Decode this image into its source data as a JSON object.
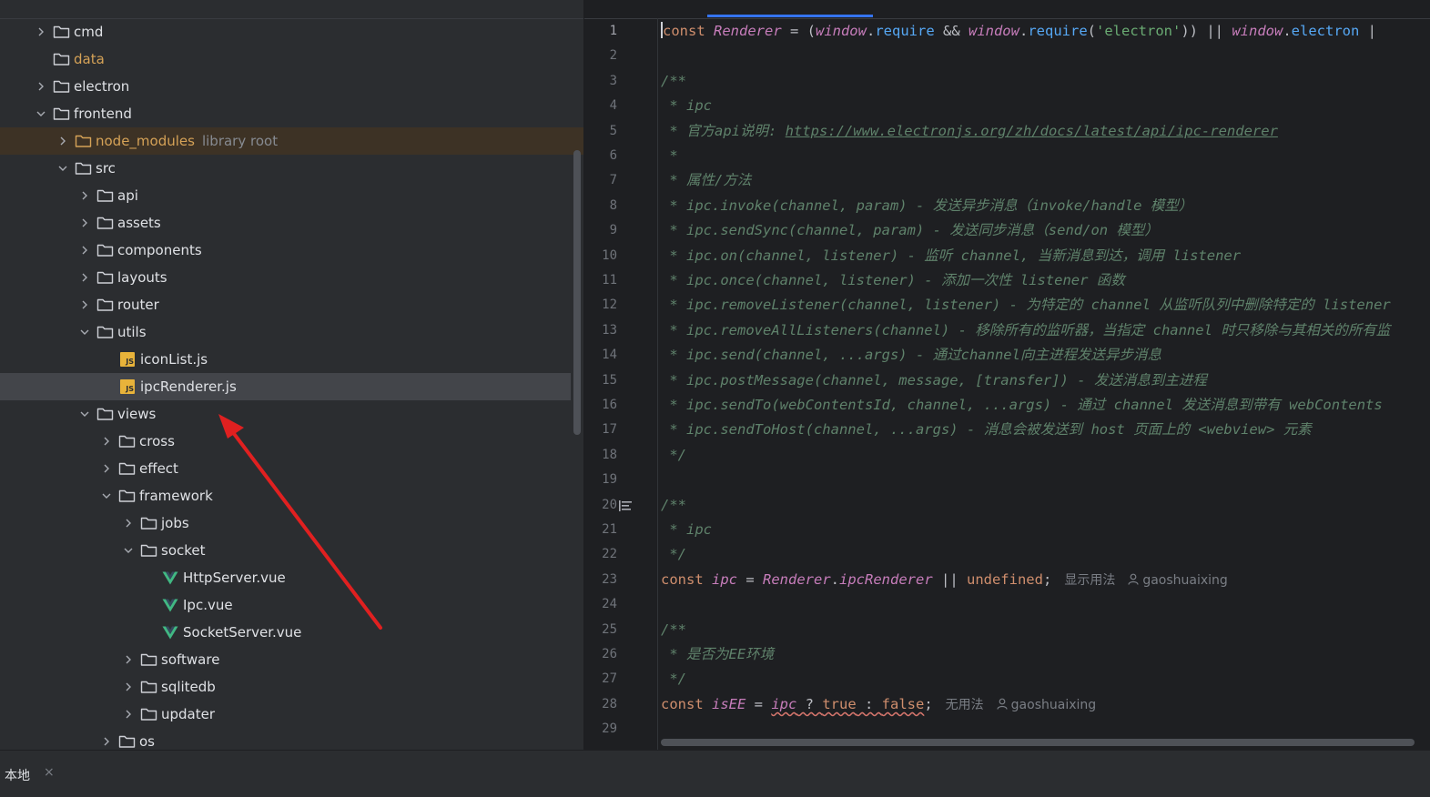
{
  "tree": {
    "items": [
      {
        "label": "cmd",
        "type": "folder",
        "depth": 0,
        "state": "collapsed"
      },
      {
        "label": "data",
        "type": "folder",
        "depth": 0,
        "state": "leaf",
        "style": "data"
      },
      {
        "label": "electron",
        "type": "folder",
        "depth": 0,
        "state": "collapsed"
      },
      {
        "label": "frontend",
        "type": "folder",
        "depth": 0,
        "state": "expanded"
      },
      {
        "label": "node_modules",
        "type": "folder",
        "depth": 1,
        "state": "collapsed",
        "style": "lib",
        "hint": "library root"
      },
      {
        "label": "src",
        "type": "folder",
        "depth": 1,
        "state": "expanded"
      },
      {
        "label": "api",
        "type": "folder",
        "depth": 2,
        "state": "collapsed"
      },
      {
        "label": "assets",
        "type": "folder",
        "depth": 2,
        "state": "collapsed"
      },
      {
        "label": "components",
        "type": "folder",
        "depth": 2,
        "state": "collapsed"
      },
      {
        "label": "layouts",
        "type": "folder",
        "depth": 2,
        "state": "collapsed"
      },
      {
        "label": "router",
        "type": "folder",
        "depth": 2,
        "state": "collapsed"
      },
      {
        "label": "utils",
        "type": "folder",
        "depth": 2,
        "state": "expanded"
      },
      {
        "label": "iconList.js",
        "type": "js",
        "depth": 3,
        "state": "leaf"
      },
      {
        "label": "ipcRenderer.js",
        "type": "js",
        "depth": 3,
        "state": "leaf",
        "selected": true
      },
      {
        "label": "views",
        "type": "folder",
        "depth": 2,
        "state": "expanded"
      },
      {
        "label": "cross",
        "type": "folder",
        "depth": 3,
        "state": "collapsed"
      },
      {
        "label": "effect",
        "type": "folder",
        "depth": 3,
        "state": "collapsed"
      },
      {
        "label": "framework",
        "type": "folder",
        "depth": 3,
        "state": "expanded"
      },
      {
        "label": "jobs",
        "type": "folder",
        "depth": 4,
        "state": "collapsed"
      },
      {
        "label": "socket",
        "type": "folder",
        "depth": 4,
        "state": "expanded"
      },
      {
        "label": "HttpServer.vue",
        "type": "vue",
        "depth": 5,
        "state": "leaf"
      },
      {
        "label": "Ipc.vue",
        "type": "vue",
        "depth": 5,
        "state": "leaf"
      },
      {
        "label": "SocketServer.vue",
        "type": "vue",
        "depth": 5,
        "state": "leaf"
      },
      {
        "label": "software",
        "type": "folder",
        "depth": 4,
        "state": "collapsed"
      },
      {
        "label": "sqlitedb",
        "type": "folder",
        "depth": 4,
        "state": "collapsed"
      },
      {
        "label": "updater",
        "type": "folder",
        "depth": 4,
        "state": "collapsed"
      },
      {
        "label": "os",
        "type": "folder",
        "depth": 3,
        "state": "collapsed"
      }
    ]
  },
  "editor": {
    "active_line": 1,
    "lines": [
      {
        "n": "1",
        "tokens": [
          [
            "caret",
            ""
          ],
          [
            "kw",
            "const "
          ],
          [
            "cls",
            "Renderer"
          ],
          [
            "op",
            " = ("
          ],
          [
            "win",
            "window"
          ],
          [
            "op",
            "."
          ],
          [
            "prop",
            "require"
          ],
          [
            "op",
            " && "
          ],
          [
            "win",
            "window"
          ],
          [
            "op",
            "."
          ],
          [
            "prop",
            "require"
          ],
          [
            "op",
            "("
          ],
          [
            "str",
            "'electron'"
          ],
          [
            "op",
            ")) || "
          ],
          [
            "win",
            "window"
          ],
          [
            "op",
            "."
          ],
          [
            "prop",
            "electron"
          ],
          [
            "op",
            " |"
          ]
        ]
      },
      {
        "n": "2",
        "tokens": []
      },
      {
        "n": "3",
        "tokens": [
          [
            "doc",
            "/**"
          ]
        ]
      },
      {
        "n": "4",
        "tokens": [
          [
            "doc",
            " * ipc"
          ]
        ]
      },
      {
        "n": "5",
        "tokens": [
          [
            "doc",
            " * 官方api说明: "
          ],
          [
            "link",
            "https://www.electronjs.org/zh/docs/latest/api/ipc-renderer"
          ]
        ]
      },
      {
        "n": "6",
        "tokens": [
          [
            "doc",
            " *"
          ]
        ]
      },
      {
        "n": "7",
        "tokens": [
          [
            "doc",
            " * 属性/方法"
          ]
        ]
      },
      {
        "n": "8",
        "tokens": [
          [
            "doc",
            " * ipc.invoke(channel, param) - 发送异步消息（invoke/handle 模型）"
          ]
        ]
      },
      {
        "n": "9",
        "tokens": [
          [
            "doc",
            " * ipc.sendSync(channel, param) - 发送同步消息（send/on 模型）"
          ]
        ]
      },
      {
        "n": "10",
        "tokens": [
          [
            "doc",
            " * ipc.on(channel, listener) - 监听 channel, 当新消息到达，调用 listener"
          ]
        ]
      },
      {
        "n": "11",
        "tokens": [
          [
            "doc",
            " * ipc.once(channel, listener) - 添加一次性 listener 函数"
          ]
        ]
      },
      {
        "n": "12",
        "tokens": [
          [
            "doc",
            " * ipc.removeListener(channel, listener) - 为特定的 channel 从监听队列中删除特定的 listener"
          ]
        ]
      },
      {
        "n": "13",
        "tokens": [
          [
            "doc",
            " * ipc.removeAllListeners(channel) - 移除所有的监听器，当指定 channel 时只移除与其相关的所有监"
          ]
        ]
      },
      {
        "n": "14",
        "tokens": [
          [
            "doc",
            " * ipc.send(channel, ...args) - 通过channel向主进程发送异步消息"
          ]
        ]
      },
      {
        "n": "15",
        "tokens": [
          [
            "doc",
            " * ipc.postMessage(channel, message, [transfer]) - 发送消息到主进程"
          ]
        ]
      },
      {
        "n": "16",
        "tokens": [
          [
            "doc",
            " * ipc.sendTo(webContentsId, channel, ...args) - 通过 channel 发送消息到带有 webContents"
          ]
        ]
      },
      {
        "n": "17",
        "tokens": [
          [
            "doc",
            " * ipc.sendToHost(channel, ...args) - 消息会被发送到 host 页面上的 <webview> 元素"
          ]
        ]
      },
      {
        "n": "18",
        "tokens": [
          [
            "doc",
            " */"
          ]
        ]
      },
      {
        "n": "19",
        "tokens": []
      },
      {
        "n": "20",
        "tokens": [
          [
            "doc",
            "/**"
          ]
        ],
        "gutter_icon": true
      },
      {
        "n": "21",
        "tokens": [
          [
            "doc",
            " * ipc"
          ]
        ]
      },
      {
        "n": "22",
        "tokens": [
          [
            "doc",
            " */"
          ]
        ]
      },
      {
        "n": "23",
        "tokens": [
          [
            "kw",
            "const "
          ],
          [
            "ivar",
            "ipc"
          ],
          [
            "op",
            " = "
          ],
          [
            "cls",
            "Renderer"
          ],
          [
            "op",
            "."
          ],
          [
            "ivar",
            "ipcRenderer"
          ],
          [
            "op",
            " || "
          ],
          [
            "lit",
            "undefined"
          ],
          [
            "op",
            ";"
          ]
        ],
        "inlay": {
          "usage": "显示用法",
          "author": "gaoshuaixing"
        }
      },
      {
        "n": "24",
        "tokens": []
      },
      {
        "n": "25",
        "tokens": [
          [
            "doc",
            "/**"
          ]
        ]
      },
      {
        "n": "26",
        "tokens": [
          [
            "doc",
            " * 是否为EE环境"
          ]
        ]
      },
      {
        "n": "27",
        "tokens": [
          [
            "doc",
            " */"
          ]
        ]
      },
      {
        "n": "28",
        "tokens": [
          [
            "kw",
            "const "
          ],
          [
            "ivar",
            "isEE"
          ],
          [
            "op",
            " = "
          ],
          [
            "errivar",
            "ipc"
          ],
          [
            "errop",
            " ? "
          ],
          [
            "errlit",
            "true"
          ],
          [
            "errop",
            " : "
          ],
          [
            "errlit",
            "false"
          ],
          [
            "op",
            ";"
          ]
        ],
        "inlay": {
          "usage": "无用法",
          "author": "gaoshuaixing"
        }
      },
      {
        "n": "29",
        "tokens": []
      }
    ]
  },
  "bottom": {
    "tab_label": "本地",
    "close_glyph": "×"
  },
  "colors": {
    "accent": "#3574f0",
    "annotation_arrow": "#e02020"
  }
}
